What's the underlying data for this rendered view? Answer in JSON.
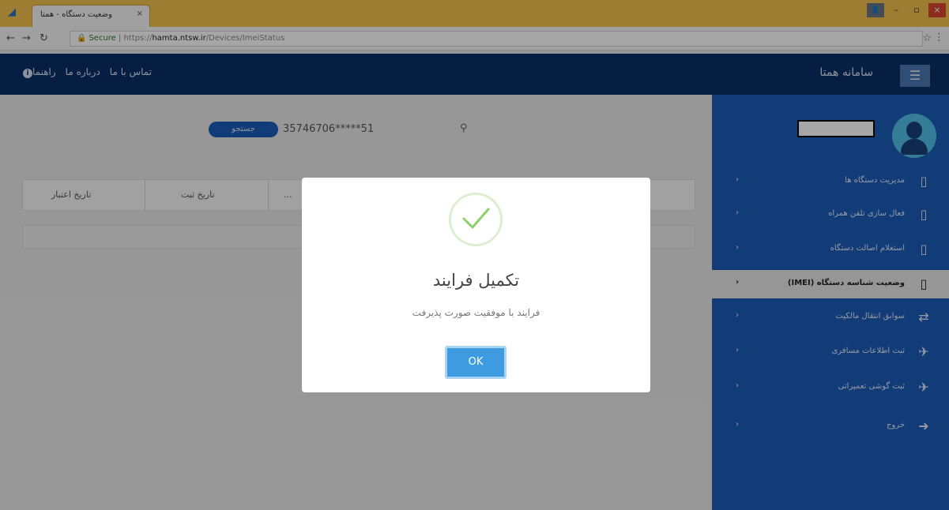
{
  "browser": {
    "tab_title": "وضعیت دستگاه - همتا",
    "tab_close": "×",
    "secure_label": "Secure",
    "url_prefix": "https://",
    "url_host": "hamta.ntsw.ir",
    "url_path": "/Devices/ImeiStatus",
    "window_controls": [
      "–",
      "▫",
      "×"
    ]
  },
  "header": {
    "brand": "سامانه همتا",
    "links": [
      "تماس با ما",
      "درباره ما",
      "راهنما"
    ]
  },
  "sidebar": {
    "items": [
      {
        "label": "مدیریت دستگاه ها",
        "icon": "phone-icon",
        "active": false
      },
      {
        "label": "فعال سازی تلفن همراه",
        "icon": "phone-plus-icon",
        "active": false
      },
      {
        "label": "استعلام اصالت دستگاه",
        "icon": "phone-search-icon",
        "active": false
      },
      {
        "label": "وضعیت شناسه دستگاه (IMEI)",
        "icon": "phone-search-icon",
        "active": true
      },
      {
        "label": "سوابق انتقال مالکیت",
        "icon": "transfer-icon",
        "active": false
      },
      {
        "label": "ثبت اطلاعات مسافری",
        "icon": "airplane-icon",
        "active": false
      },
      {
        "label": "ثبت گوشی تعمیراتی",
        "icon": "airplane-icon",
        "active": false
      },
      {
        "label": "خروج",
        "icon": "logout-icon",
        "active": false
      }
    ]
  },
  "search": {
    "button_label": "جستجو",
    "value": "35746706*****51"
  },
  "table": {
    "columns": [
      "تاریخ اعتبار",
      "تاریخ ثبت",
      "..."
    ]
  },
  "modal": {
    "title": "تکمیل فرایند",
    "message": "فرایند با موفقیت صورت پذیرفت",
    "ok_label": "OK",
    "accent_color": "#3f9be0",
    "check_color": "#8bd06a"
  }
}
